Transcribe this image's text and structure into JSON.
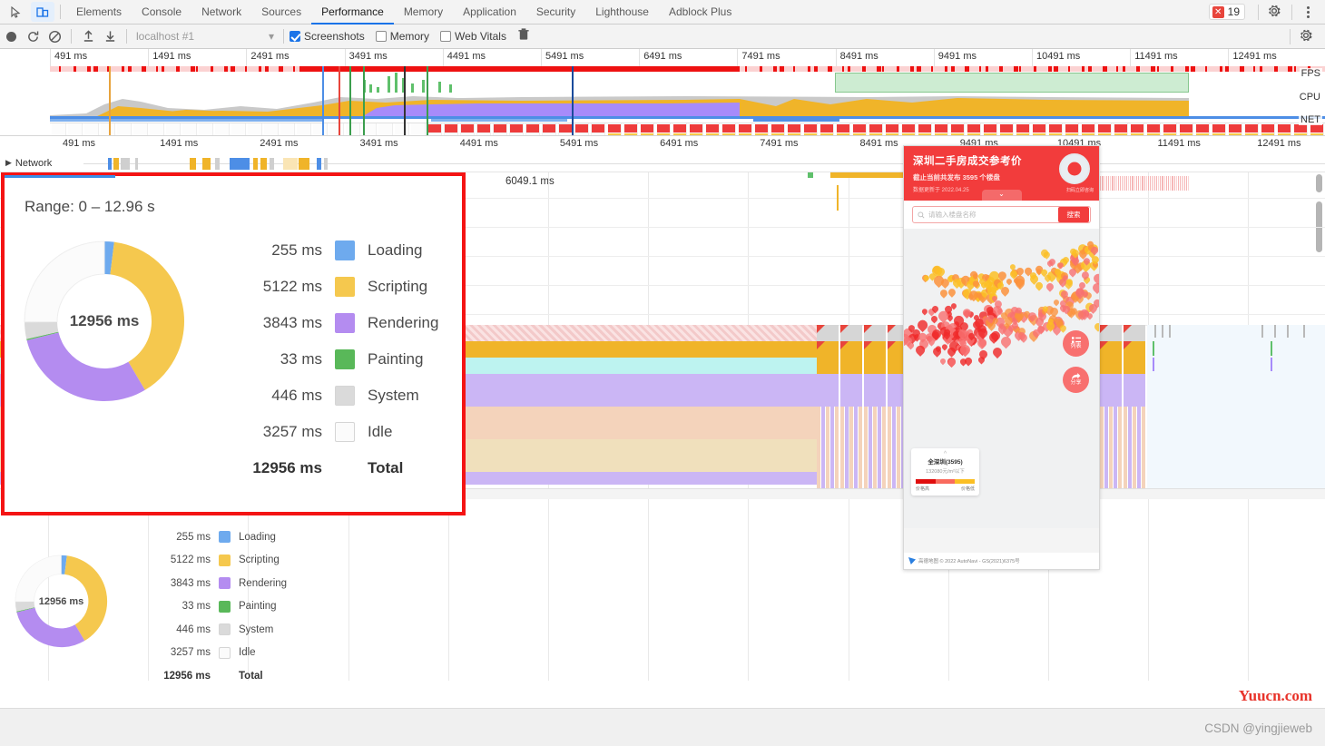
{
  "tabbar": {
    "icons": [
      {
        "name": "inspect-element-icon",
        "glyph": "↖"
      },
      {
        "name": "device-toolbar-icon",
        "glyph": "▢"
      }
    ],
    "tabs": [
      {
        "label": "Elements",
        "active": false
      },
      {
        "label": "Console",
        "active": false
      },
      {
        "label": "Network",
        "active": false
      },
      {
        "label": "Sources",
        "active": false
      },
      {
        "label": "Performance",
        "active": true
      },
      {
        "label": "Memory",
        "active": false
      },
      {
        "label": "Application",
        "active": false
      },
      {
        "label": "Security",
        "active": false
      },
      {
        "label": "Lighthouse",
        "active": false
      },
      {
        "label": "Adblock Plus",
        "active": false
      }
    ],
    "error_count": "19",
    "error_icon": "✕",
    "settings_icon": "gear-icon",
    "more_icon": "kebab-menu-icon"
  },
  "toolbar": {
    "record_icon": "record-icon",
    "reload_icon": "reload-and-record-icon",
    "clear_icon": "clear-recording-icon",
    "upload_icon": "load-profile-icon",
    "download_icon": "save-profile-icon",
    "session_value": "localhost #1",
    "dropdown_icon": "▾",
    "screenshots_label": "Screenshots",
    "screenshots_checked": true,
    "memory_label": "Memory",
    "memory_checked": false,
    "web_vitals_label": "Web Vitals",
    "web_vitals_checked": false,
    "trash_icon": "collect-garbage-icon",
    "settings_icon": "capture-settings-icon"
  },
  "overview": {
    "ruler_ticks": [
      "491 ms",
      "1491 ms",
      "2491 ms",
      "3491 ms",
      "4491 ms",
      "5491 ms",
      "6491 ms",
      "7491 ms",
      "8491 ms",
      "9491 ms",
      "10491 ms",
      "11491 ms",
      "12491 ms"
    ],
    "lane_labels": [
      "FPS",
      "CPU",
      "NET"
    ]
  },
  "timeline": {
    "ruler_ticks": [
      "491 ms",
      "1491 ms",
      "2491 ms",
      "3491 ms",
      "4491 ms",
      "5491 ms",
      "6491 ms",
      "7491 ms",
      "8491 ms",
      "9491 ms",
      "10491 ms",
      "11491 ms",
      "12491 ms"
    ],
    "network_label": "Network",
    "network_caret": "▶",
    "time_marker": "6049.1 ms"
  },
  "summary": {
    "range_label": "Range: 0 – 12.96 s",
    "center_total": "12956 ms",
    "rows": [
      {
        "value": "255 ms",
        "label": "Loading",
        "color": "#6eaaee"
      },
      {
        "value": "5122 ms",
        "label": "Scripting",
        "color": "#f5c84e"
      },
      {
        "value": "3843 ms",
        "label": "Rendering",
        "color": "#b48cf0"
      },
      {
        "value": "33 ms",
        "label": "Painting",
        "color": "#59b859"
      },
      {
        "value": "446 ms",
        "label": "System",
        "color": "#dadada"
      },
      {
        "value": "3257 ms",
        "label": "Idle",
        "color": "#fbfbfb"
      }
    ],
    "total_value": "12956 ms",
    "total_label": "Total"
  },
  "chart_data": {
    "type": "pie",
    "title": "Range: 0 – 12.96 s",
    "categories": [
      "Loading",
      "Scripting",
      "Rendering",
      "Painting",
      "System",
      "Idle"
    ],
    "values": [
      255,
      5122,
      3843,
      33,
      446,
      3257
    ],
    "unit": "ms",
    "total": 12956,
    "colors": [
      "#6eaaee",
      "#f5c84e",
      "#b48cf0",
      "#59b859",
      "#dadada",
      "#fbfbfb"
    ],
    "legend": "right",
    "center_label": "12956 ms"
  },
  "popup": {
    "title": "深圳二手房成交参考价",
    "subtitle": "截止当前共发布 3595 个楼盘",
    "updated": "数据更新于 2022.04.25",
    "seal_label": "扫码立即咨询",
    "collapse_icon": "⌄",
    "search_placeholder": "请输入楼盘名称",
    "search_icon": "⚲",
    "search_button": "搜索",
    "fab_list": "列表",
    "fab_share": "分享",
    "card_title": "全深圳(3595)",
    "card_sub": "132080元/m²以下",
    "legend_high": "价格高",
    "legend_low": "价格低",
    "footer": "高德地图 © 2022 AutoNavi - GS(2021)6375号"
  },
  "watermarks": {
    "site": "Yuucn.com",
    "author": "CSDN @yingjieweb"
  },
  "colors": {
    "accent": "#1a73e8",
    "highlight_box": "#f41414",
    "error": "#e8453c",
    "popup_brand": "#f23c3c"
  }
}
